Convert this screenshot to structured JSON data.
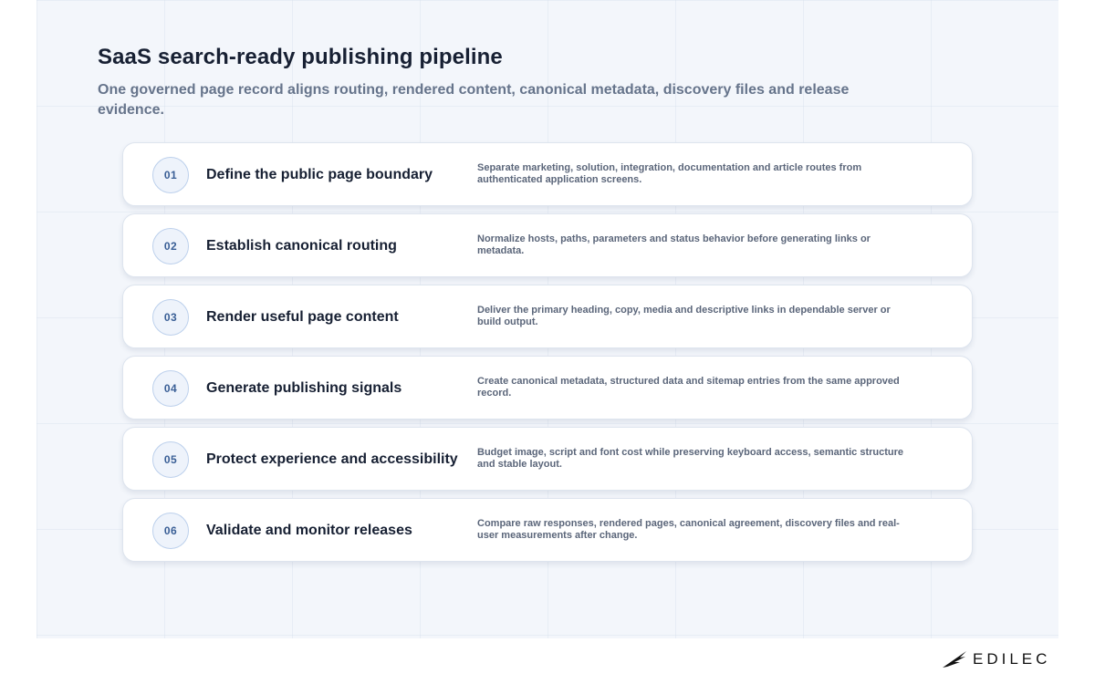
{
  "header": {
    "title": "SaaS search-ready publishing pipeline",
    "subtitle": "One governed page record aligns routing, rendered content, canonical metadata, discovery files and release evidence."
  },
  "steps": [
    {
      "number": "01",
      "title": "Define the public page boundary",
      "description": "Separate marketing, solution, integration, documentation and article routes from authenticated application screens."
    },
    {
      "number": "02",
      "title": "Establish canonical routing",
      "description": "Normalize hosts, paths, parameters and status behavior before generating links or metadata."
    },
    {
      "number": "03",
      "title": "Render useful page content",
      "description": "Deliver the primary heading, copy, media and descriptive links in dependable server or build output."
    },
    {
      "number": "04",
      "title": "Generate publishing signals",
      "description": "Create canonical metadata, structured data and sitemap entries from the same approved record."
    },
    {
      "number": "05",
      "title": "Protect experience and accessibility",
      "description": "Budget image, script and font cost while preserving keyboard access, semantic structure and stable layout."
    },
    {
      "number": "06",
      "title": "Validate and monitor releases",
      "description": "Compare raw responses, rendered pages, canonical agreement, discovery files and real-user measurements after change."
    }
  ],
  "logo": {
    "text": "EDILEC",
    "icon": "wing-mark-icon"
  }
}
